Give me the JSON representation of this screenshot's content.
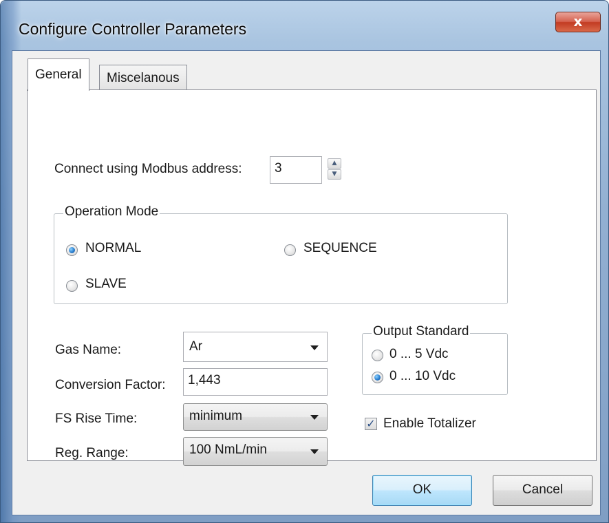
{
  "window": {
    "title": "Configure Controller Parameters",
    "close_glyph": "x"
  },
  "tabs": [
    {
      "label": "General",
      "active": true
    },
    {
      "label": "Miscelanous",
      "active": false
    }
  ],
  "modbus": {
    "label": "Connect using Modbus address:",
    "value": "3",
    "spin_up": "▲",
    "spin_down": "▼"
  },
  "operation_mode": {
    "legend": "Operation Mode",
    "options": [
      {
        "label": "NORMAL",
        "selected": true
      },
      {
        "label": "SEQUENCE",
        "selected": false
      },
      {
        "label": "SLAVE",
        "selected": false
      }
    ]
  },
  "gas_name": {
    "label": "Gas Name:",
    "value": "Ar"
  },
  "conversion_factor": {
    "label": "Conversion Factor:",
    "value": "1,443"
  },
  "fs_rise_time": {
    "label": "FS Rise Time:",
    "value": "minimum"
  },
  "reg_range": {
    "label": "Reg. Range:",
    "value": "100 NmL/min"
  },
  "output_standard": {
    "legend": "Output Standard",
    "options": [
      {
        "label": "0 ... 5 Vdc",
        "selected": false
      },
      {
        "label": "0 ... 10 Vdc",
        "selected": true
      }
    ]
  },
  "enable_totalizer": {
    "label": "Enable Totalizer",
    "checked": true,
    "check_glyph": "✓"
  },
  "buttons": {
    "ok": "OK",
    "cancel": "Cancel"
  },
  "colors": {
    "accent": "#2a7fd0",
    "close_button": "#c23b22",
    "default_button": "#bee6fd"
  }
}
